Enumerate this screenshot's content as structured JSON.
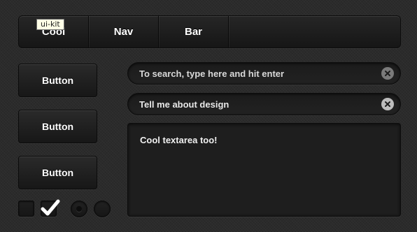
{
  "tooltip": {
    "text": "ui-kit"
  },
  "nav": {
    "items": [
      {
        "label": "Cool"
      },
      {
        "label": "Nav"
      },
      {
        "label": "Bar"
      }
    ]
  },
  "buttons": {
    "items": [
      {
        "label": "Button"
      },
      {
        "label": "Button"
      },
      {
        "label": "Button"
      }
    ]
  },
  "search": {
    "placeholder": "To search, type here and hit enter",
    "clear_icon": "clear-x-icon"
  },
  "design_field": {
    "value": "Tell me about design",
    "clear_icon": "clear-x-icon"
  },
  "textarea": {
    "value": "Cool textarea too!"
  },
  "checkboxes": [
    {
      "checked": false
    },
    {
      "checked": true,
      "icon": "checkmark-icon"
    }
  ],
  "radios": [
    {
      "selected": true
    },
    {
      "selected": false
    }
  ],
  "colors": {
    "background": "#2b2b2b",
    "surface": "#1e1e1e",
    "text": "#ffffff"
  }
}
